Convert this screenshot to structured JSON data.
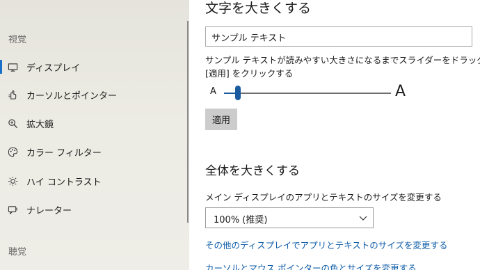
{
  "sidebar": {
    "section_vision": "視覚",
    "items": [
      {
        "label": "ディスプレイ",
        "icon": "monitor-icon",
        "selected": true
      },
      {
        "label": "カーソルとポインター",
        "icon": "pointer-hand-icon",
        "selected": false
      },
      {
        "label": "拡大鏡",
        "icon": "magnifier-icon",
        "selected": false
      },
      {
        "label": "カラー フィルター",
        "icon": "color-palette-icon",
        "selected": false
      },
      {
        "label": "ハイ コントラスト",
        "icon": "sun-contrast-icon",
        "selected": false
      },
      {
        "label": "ナレーター",
        "icon": "narrator-icon",
        "selected": false
      }
    ],
    "section_hearing": "聴覚"
  },
  "main": {
    "text_size": {
      "heading": "文字を大きくする",
      "sample_text": "サンプル テキスト",
      "description_line1": "サンプル テキストが読みやすい大きさになるまでスライダーをドラッグし、",
      "description_line2": "[適用] をクリックする",
      "slider_small_label": "A",
      "slider_large_label": "A",
      "slider_value_percent": 100,
      "apply_label": "適用"
    },
    "everything_size": {
      "heading": "全体を大きくする",
      "description": "メイン ディスプレイのアプリとテキストのサイズを変更する",
      "dropdown_value": "100% (推奨)",
      "link_other_displays": "その他のディスプレイでアプリとテキストのサイズを変更する",
      "link_cursor": "カーソルとマウス ポインターの色とサイズを変更する"
    }
  },
  "colors": {
    "accent": "#1a6fc9",
    "slider": "#1a5a9e",
    "link": "#0e5ca8",
    "sidebar_bg": "#ecebe4"
  }
}
